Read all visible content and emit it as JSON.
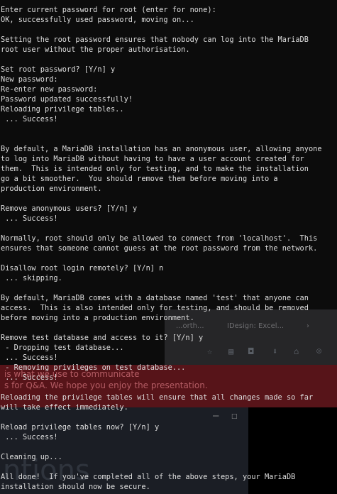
{
  "terminal": {
    "lines": [
      "Enter current password for root (enter for none):",
      "OK, successfully used password, moving on...",
      "",
      "Setting the root password ensures that nobody can log into the MariaDB",
      "root user without the proper authorisation.",
      "",
      "Set root password? [Y/n] y",
      "New password:",
      "Re-enter new password:",
      "Password updated successfully!",
      "Reloading privilege tables..",
      " ... Success!",
      "",
      "",
      "By default, a MariaDB installation has an anonymous user, allowing anyone",
      "to log into MariaDB without having to have a user account created for",
      "them.  This is intended only for testing, and to make the installation",
      "go a bit smoother.  You should remove them before moving into a",
      "production environment.",
      "",
      "Remove anonymous users? [Y/n] y",
      " ... Success!",
      "",
      "Normally, root should only be allowed to connect from 'localhost'.  This",
      "ensures that someone cannot guess at the root password from the network.",
      "",
      "Disallow root login remotely? [Y/n] n",
      " ... skipping.",
      "",
      "By default, MariaDB comes with a database named 'test' that anyone can",
      "access.  This is also intended only for testing, and should be removed",
      "before moving into a production environment.",
      "",
      "Remove test database and access to it? [Y/n] y",
      " - Dropping test database...",
      " ... Success!",
      " - Removing privileges on test database...",
      " ... Success!",
      "",
      "Reloading the privilege tables will ensure that all changes made so far",
      "will take effect immediately.",
      "",
      "Reload privilege tables now? [Y/n] y",
      " ... Success!",
      "",
      "Cleaning up...",
      "",
      "All done!  If you've completed all of the above steps, your MariaDB",
      "installation should now be secure."
    ]
  },
  "background": {
    "browser_tabs": [
      "...orth...",
      "IDesign: Excel...",
      "..."
    ],
    "banner_lines": [
      "is what we use to communicate",
      "s for Q&A. We hope you enjoy the presentation."
    ],
    "big_text": "ntions"
  },
  "colors": {
    "terminal_bg": "#0c0c0c",
    "terminal_fg": "#dedede",
    "banner": "#961c24"
  }
}
